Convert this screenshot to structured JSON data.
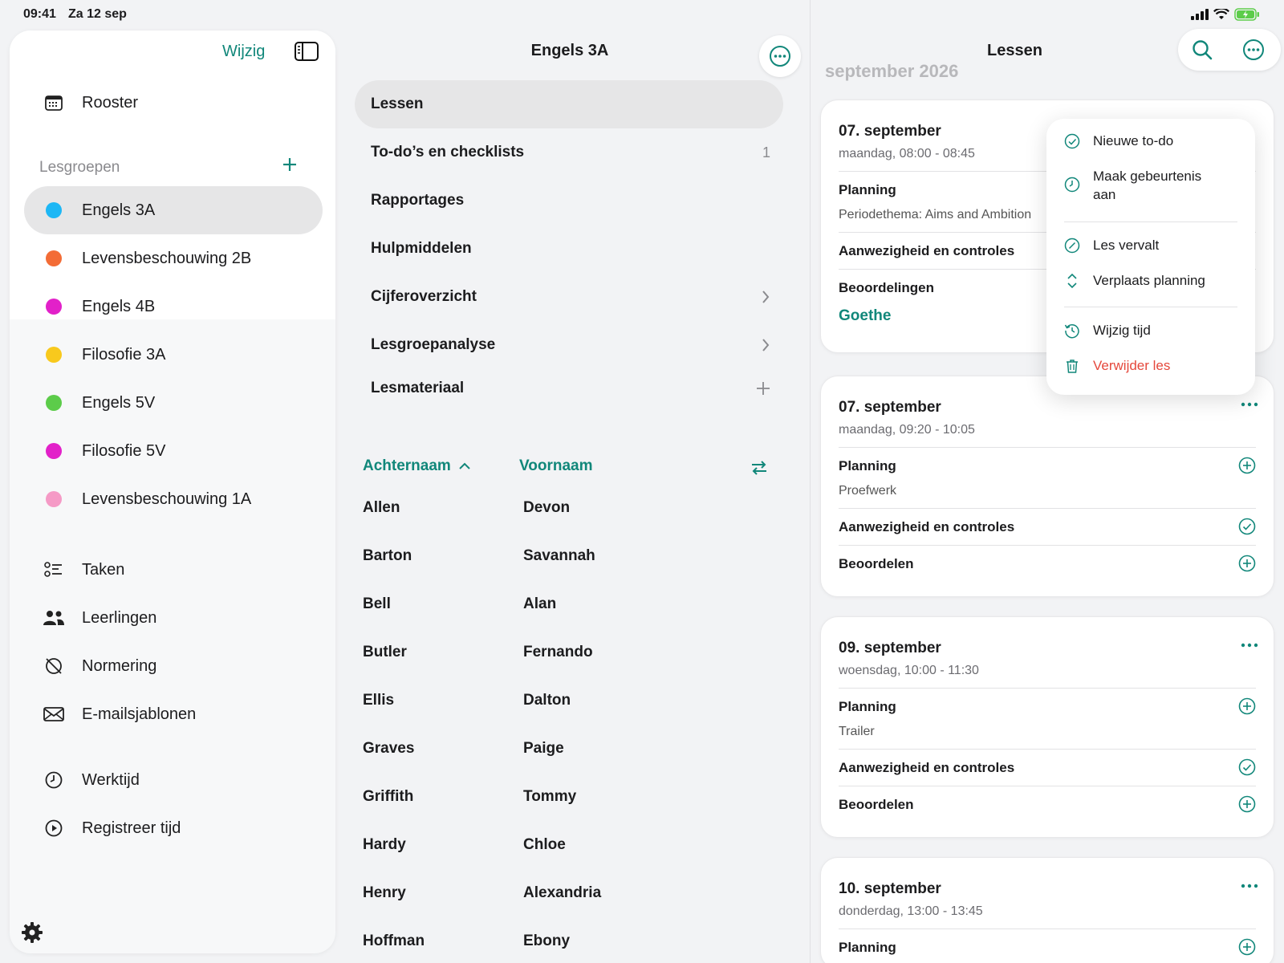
{
  "status_bar": {
    "time": "09:41",
    "date": "Za 12 sep",
    "icons": [
      "signal-icon",
      "wifi-icon",
      "battery-icon"
    ]
  },
  "sidebar": {
    "edit_label": "Wijzig",
    "top_items": [
      {
        "label": "Rooster",
        "icon": "calendar-icon"
      }
    ],
    "groups_section": "Lesgroepen",
    "groups": [
      {
        "label": "Engels 3A",
        "color": "#1db7f5",
        "selected": true
      },
      {
        "label": "Levensbeschouwing 2B",
        "color": "#f36c36"
      },
      {
        "label": "Engels 4B",
        "color": "#e221c9"
      },
      {
        "label": "Filosofie 3A",
        "color": "#f8c91d"
      },
      {
        "label": "Engels 5V",
        "color": "#5ccc4a"
      },
      {
        "label": "Filosofie 5V",
        "color": "#e221c9"
      },
      {
        "label": "Levensbeschouwing 1A",
        "color": "#f59ac6"
      }
    ],
    "tools": [
      {
        "label": "Taken",
        "icon": "checklist-icon"
      },
      {
        "label": "Leerlingen",
        "icon": "people-icon"
      },
      {
        "label": "Normering",
        "icon": "norm-icon"
      },
      {
        "label": "E-mailsjablonen",
        "icon": "envelope-icon"
      }
    ],
    "time_items": [
      {
        "label": "Werktijd",
        "icon": "clock-icon"
      },
      {
        "label": "Registreer tijd",
        "icon": "play-icon"
      }
    ]
  },
  "middle": {
    "title": "Engels 3A",
    "items": [
      {
        "label": "Lessen",
        "selected": true
      },
      {
        "label": "To-do’s en checklists",
        "trail": "1"
      },
      {
        "label": "Rapportages"
      },
      {
        "label": "Hulpmiddelen"
      },
      {
        "label": "Cijferoverzicht",
        "trail_icon": "chevron-right-icon"
      },
      {
        "label": "Lesgroepanalyse",
        "trail_icon": "chevron-right-icon"
      },
      {
        "label": "Lesmateriaal",
        "trail_icon": "plus-icon"
      }
    ],
    "sort": {
      "last_name": "Achternaam",
      "first_name": "Voornaam"
    },
    "students": [
      {
        "last": "Allen",
        "first": "Devon"
      },
      {
        "last": "Barton",
        "first": "Savannah"
      },
      {
        "last": "Bell",
        "first": "Alan"
      },
      {
        "last": "Butler",
        "first": "Fernando"
      },
      {
        "last": "Ellis",
        "first": "Dalton"
      },
      {
        "last": "Graves",
        "first": "Paige"
      },
      {
        "last": "Griffith",
        "first": "Tommy"
      },
      {
        "last": "Hardy",
        "first": "Chloe"
      },
      {
        "last": "Henry",
        "first": "Alexandria"
      },
      {
        "last": "Hoffman",
        "first": "Ebony"
      }
    ]
  },
  "right": {
    "title": "Lessen",
    "month": "september 2026",
    "lessons": [
      {
        "date": "07. september",
        "time": "maandag, 08:00 - 08:45",
        "planning": "Planning",
        "planning_text": "Periodethema: Aims and Ambition",
        "attendance": "Aanwezigheid en controles",
        "grading": "Beoordelingen",
        "grading_value": "Goethe"
      },
      {
        "date": "07. september",
        "time": "maandag, 09:20 - 10:05",
        "planning": "Planning",
        "planning_text": "Proefwerk",
        "attendance": "Aanwezigheid en controles",
        "grading": "Beoordelen"
      },
      {
        "date": "09. september",
        "time": "woensdag, 10:00 - 11:30",
        "planning": "Planning",
        "planning_text": "Trailer",
        "attendance": "Aanwezigheid en controles",
        "grading": "Beoordelen"
      },
      {
        "date": "10. september",
        "time": "donderdag, 13:00 - 13:45",
        "planning": "Planning"
      }
    ]
  },
  "context_menu": {
    "items": [
      {
        "label": "Nieuwe to-do",
        "icon": "check-circle-icon"
      },
      {
        "label": "Maak gebeurtenis aan",
        "icon": "clock-icon"
      },
      {
        "label": "Les vervalt",
        "icon": "slash-circle-icon"
      },
      {
        "label": "Verplaats planning",
        "icon": "up-down-icon"
      },
      {
        "label": "Wijzig tijd",
        "icon": "clock-reset-icon"
      },
      {
        "label": "Verwijder les",
        "icon": "trash-icon",
        "destructive": true
      }
    ]
  },
  "colors": {
    "accent": "#11877a",
    "destructive": "#e5483c"
  }
}
